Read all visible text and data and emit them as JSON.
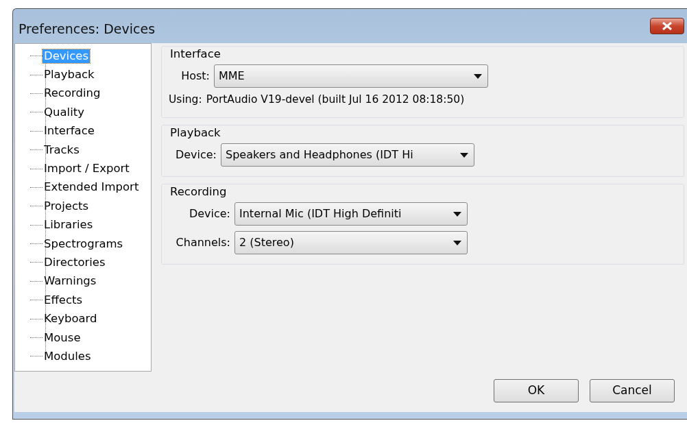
{
  "window": {
    "title": "Preferences: Devices"
  },
  "tree": {
    "items": [
      {
        "label": "Devices",
        "selected": true
      },
      {
        "label": "Playback",
        "selected": false
      },
      {
        "label": "Recording",
        "selected": false
      },
      {
        "label": "Quality",
        "selected": false
      },
      {
        "label": "Interface",
        "selected": false
      },
      {
        "label": "Tracks",
        "selected": false
      },
      {
        "label": "Import / Export",
        "selected": false
      },
      {
        "label": "Extended Import",
        "selected": false
      },
      {
        "label": "Projects",
        "selected": false
      },
      {
        "label": "Libraries",
        "selected": false
      },
      {
        "label": "Spectrograms",
        "selected": false
      },
      {
        "label": "Directories",
        "selected": false
      },
      {
        "label": "Warnings",
        "selected": false
      },
      {
        "label": "Effects",
        "selected": false
      },
      {
        "label": "Keyboard",
        "selected": false
      },
      {
        "label": "Mouse",
        "selected": false
      },
      {
        "label": "Modules",
        "selected": false
      }
    ]
  },
  "groups": [
    {
      "title": "Interface",
      "rows": [
        {
          "kind": "combo",
          "label": "Host:",
          "value": "MME"
        },
        {
          "kind": "info",
          "label": "Using:",
          "value": "PortAudio V19-devel (built Jul 16 2012 08:18:50)"
        }
      ]
    },
    {
      "title": "Playback",
      "rows": [
        {
          "kind": "combo",
          "label": "Device:",
          "value": "Speakers and Headphones (IDT Hi"
        }
      ]
    },
    {
      "title": "Recording",
      "rows": [
        {
          "kind": "combo",
          "label": "Device:",
          "value": "Internal Mic (IDT High Definiti"
        },
        {
          "kind": "combo",
          "label": "Channels:",
          "value": "2 (Stereo)"
        }
      ]
    }
  ],
  "buttons": [
    "OK",
    "Cancel"
  ]
}
